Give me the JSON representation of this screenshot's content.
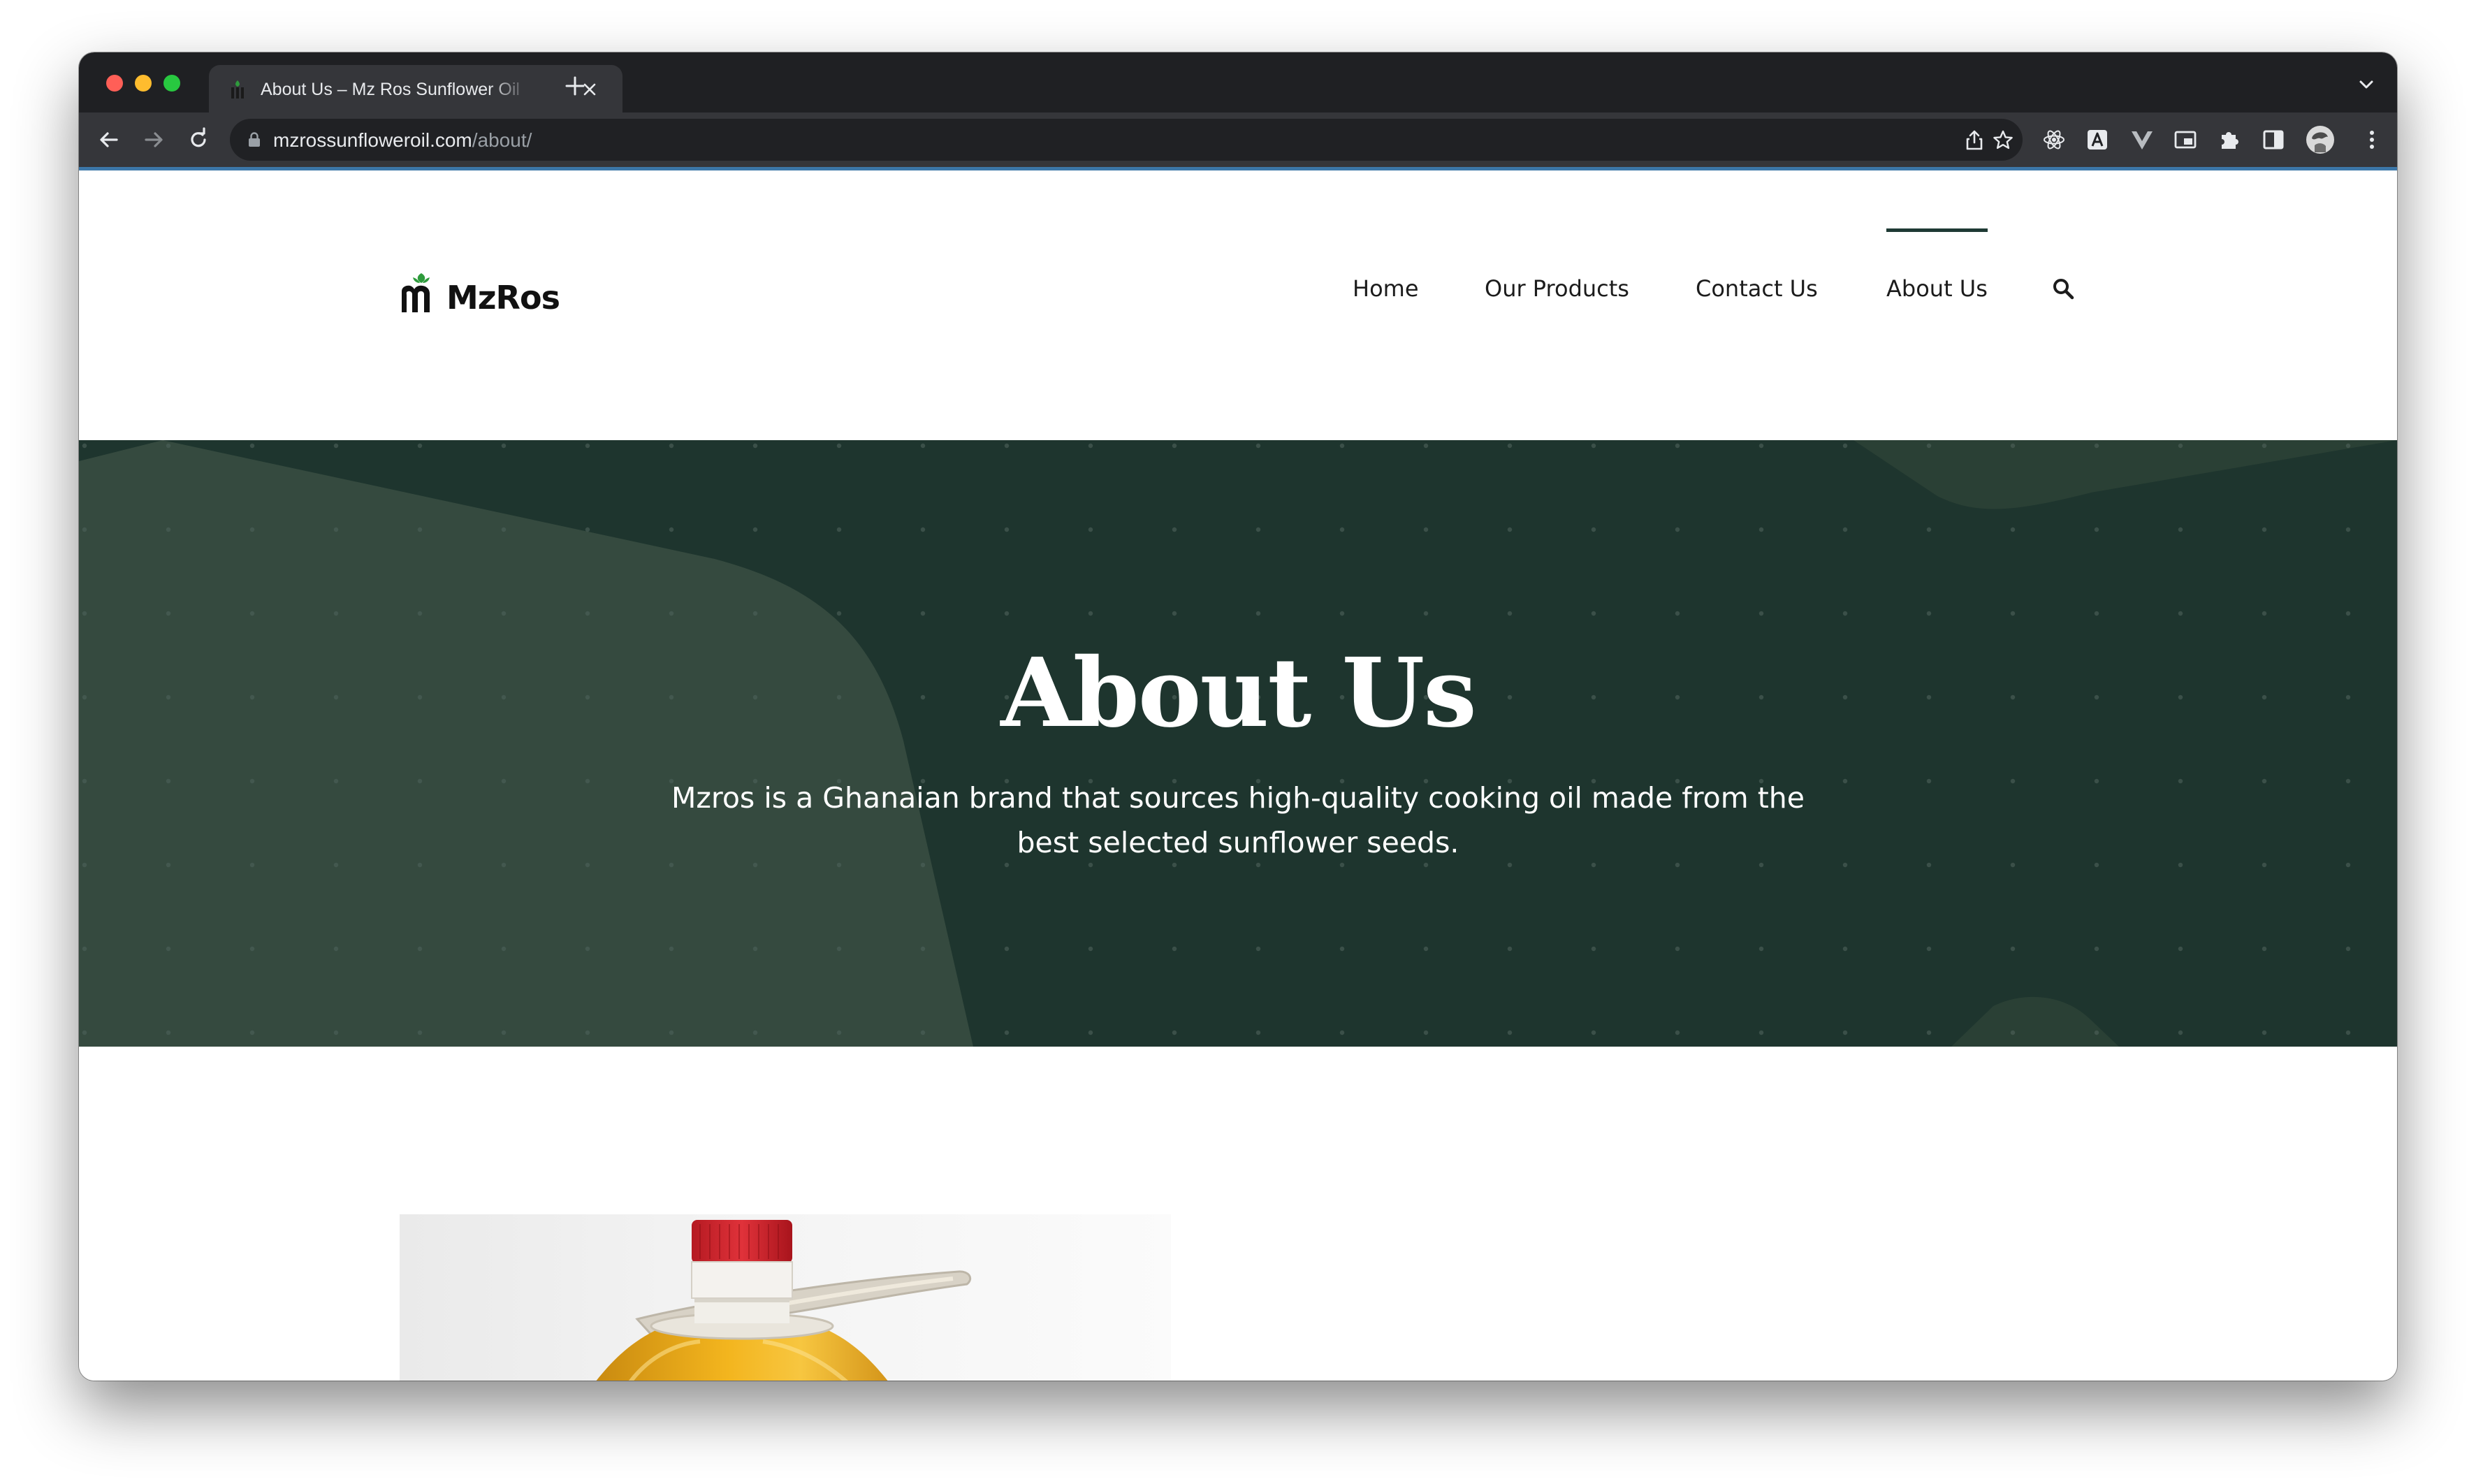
{
  "browser": {
    "tab_title": "About Us – Mz Ros Sunflower Oil",
    "url_domain": "mzrossunfloweroil.com",
    "url_path": "/about/"
  },
  "site": {
    "logo_text": "MzRos",
    "nav": [
      {
        "label": "Home",
        "active": false
      },
      {
        "label": "Our Products",
        "active": false
      },
      {
        "label": "Contact Us",
        "active": false
      },
      {
        "label": "About Us",
        "active": true
      }
    ],
    "colors": {
      "hero_bg": "#1e352e",
      "hero_shape": "#354a3f",
      "logo_green": "#2e9b3c",
      "nav_active": "#1e3a34"
    }
  },
  "hero": {
    "title": "About Us",
    "description": "Mzros is a Ghanaian brand that sources high-quality cooking oil made from the best selected sunflower seeds."
  },
  "content": {
    "image": "sunflower-oil-bottle"
  }
}
